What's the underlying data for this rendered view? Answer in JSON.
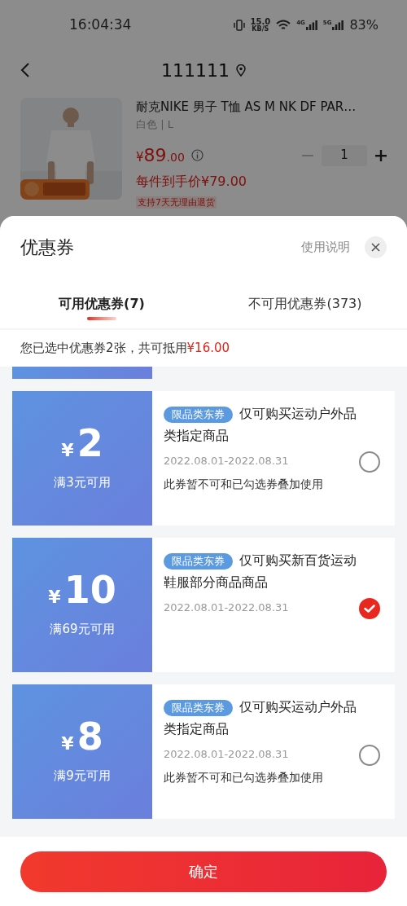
{
  "status_bar": {
    "time": "16:04:34",
    "speed_value": "15.0",
    "speed_unit": "KB/S",
    "networks": [
      "4G",
      "5G"
    ],
    "battery": "83%"
  },
  "header": {
    "title": "111111"
  },
  "product": {
    "name": "耐克NIKE 男子 T恤 AS M NK DF PAR…",
    "spec": "白色 | L",
    "currency": "¥",
    "price": "89",
    "price_decimal": ".00",
    "quantity": "1",
    "final_price": "每件到手价¥79.00",
    "return_tag": "支持7天无理由退货"
  },
  "sheet": {
    "title": "优惠券",
    "help": "使用说明",
    "tabs": [
      {
        "label": "可用优惠券(7)",
        "selected": true
      },
      {
        "label": "不可用优惠券(373)",
        "selected": false
      }
    ],
    "summary": "您已选中优惠券2张，共可抵用",
    "summary_amount": "¥16.00",
    "coupons": [
      {
        "currency": "¥",
        "amount": "2",
        "condition": "满3元可用",
        "tag": "限品类东券",
        "description": "仅可购买运动户外品类指定商品",
        "validity": "2022.08.01-2022.08.31",
        "note": "此券暂不可和已勾选券叠加使用",
        "selected": false
      },
      {
        "currency": "¥",
        "amount": "10",
        "condition": "满69元可用",
        "tag": "限品类东券",
        "description": "仅可购买新百货运动鞋服部分商品商品",
        "validity": "2022.08.01-2022.08.31",
        "selected": true
      },
      {
        "currency": "¥",
        "amount": "8",
        "condition": "满9元可用",
        "tag": "限品类东券",
        "description": "仅可购买运动户外品类指定商品",
        "validity": "2022.08.01-2022.08.31",
        "note": "此券暂不可和已勾选券叠加使用",
        "selected": false
      }
    ],
    "confirm": "确定"
  }
}
